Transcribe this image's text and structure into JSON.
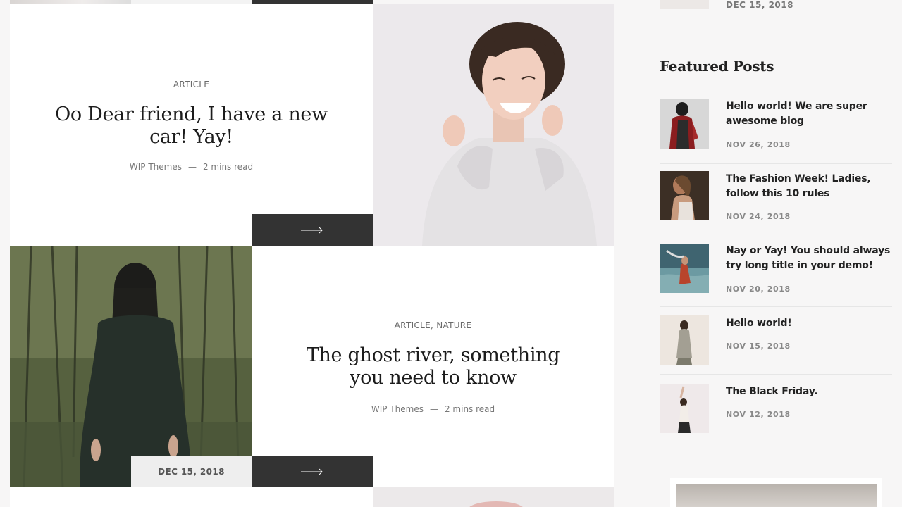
{
  "main": {
    "top_partial": {},
    "card1": {
      "category": "ARTICLE",
      "title": "Oo Dear friend, I have a new car! Yay!",
      "author": "WIP Themes",
      "separator": "—",
      "read_time": "2 mins read",
      "arrow_icon": "arrow-right-icon"
    },
    "card2": {
      "categories": [
        "ARTICLE",
        "NATURE"
      ],
      "category_separator": ",",
      "title": "The ghost river, something you need to know",
      "author": "WIP Themes",
      "separator": "—",
      "read_time": "2 mins read",
      "date": "DEC 15, 2018",
      "arrow_icon": "arrow-right-icon"
    }
  },
  "sidebar": {
    "top_date": "DEC 15, 2018",
    "featured_heading": "Featured Posts",
    "featured": [
      {
        "title": "Hello world! We are super awesome blog",
        "date": "NOV 26, 2018"
      },
      {
        "title": "The Fashion Week! Ladies, follow this 10 rules",
        "date": "NOV 24, 2018"
      },
      {
        "title": "Nay or Yay! You should always try long title in your demo!",
        "date": "NOV 20, 2018"
      },
      {
        "title": "Hello world!",
        "date": "NOV 15, 2018"
      },
      {
        "title": "The Black Friday.",
        "date": "NOV 12, 2018"
      }
    ]
  },
  "colors": {
    "dark_block": "#333333",
    "page_bg": "#f7f6f6",
    "card_bg": "#ffffff"
  }
}
